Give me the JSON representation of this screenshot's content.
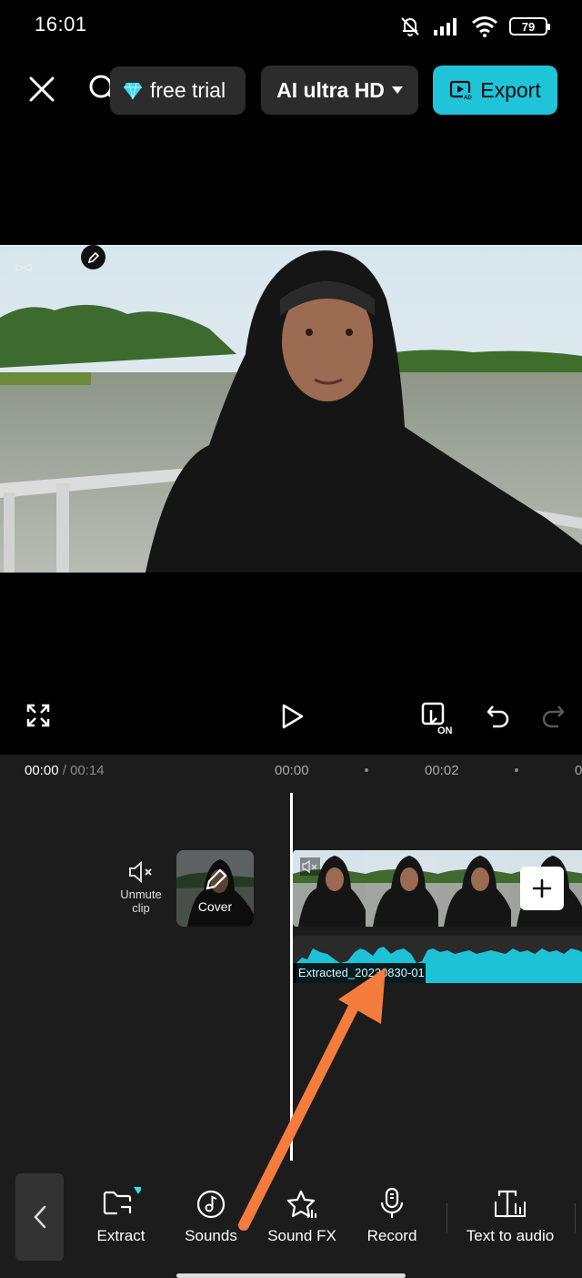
{
  "status": {
    "time": "16:01",
    "battery": "79"
  },
  "topbar": {
    "trial_label": "free trial",
    "quality_label": "AI ultra HD",
    "export_label": "Export"
  },
  "timeline": {
    "current_time": "00:00",
    "separator": " / ",
    "total_time": "00:14",
    "ruler_marks": [
      "00:00",
      "00:02",
      "0"
    ],
    "unmute_label": "Unmute clip",
    "cover_label": "Cover",
    "audio_clip_name": "Extracted_20230830-01"
  },
  "toolbar": {
    "items": [
      {
        "label": "Extract",
        "icon": "extract-folder-icon"
      },
      {
        "label": "Sounds",
        "icon": "music-note-icon"
      },
      {
        "label": "Sound FX",
        "icon": "star-sound-icon"
      },
      {
        "label": "Record",
        "icon": "microphone-icon"
      },
      {
        "label": "Text to audio",
        "icon": "text-to-audio-icon"
      }
    ]
  },
  "colors": {
    "accent": "#1fc4d9",
    "background": "#000000",
    "panel": "#1c1c1c",
    "annotation_arrow": "#f47c3c"
  }
}
